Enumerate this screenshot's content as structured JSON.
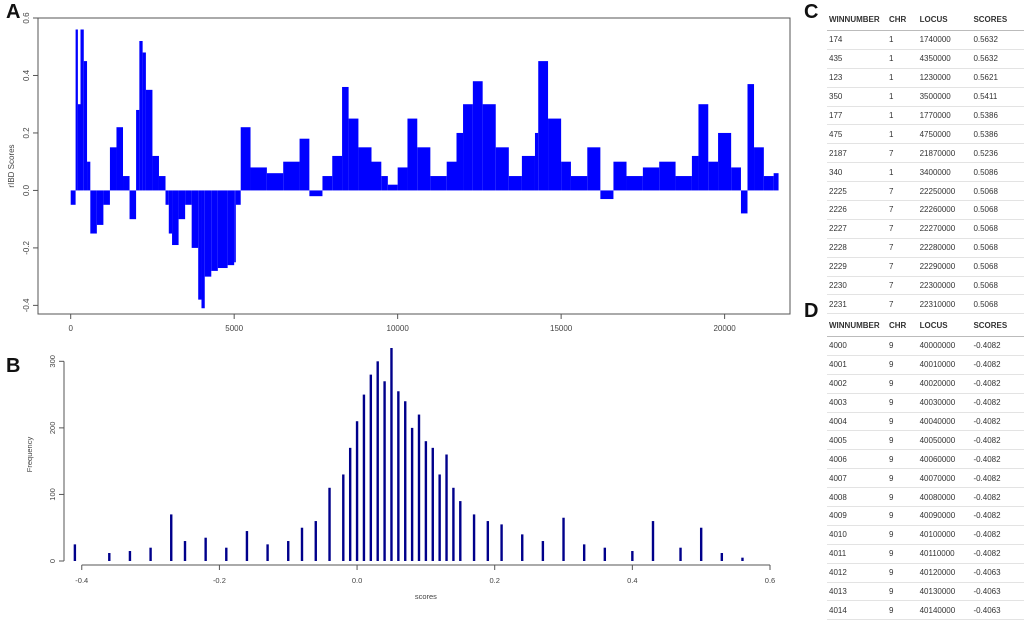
{
  "panels": {
    "a": "A",
    "b": "B",
    "c": "C",
    "d": "D"
  },
  "chart_data": [
    {
      "type": "bar",
      "ylabel": "rIBD Scores",
      "xlabel": "",
      "xlim": [
        -1000,
        22000
      ],
      "ylim": [
        -0.43,
        0.6
      ],
      "xticks": [
        "0",
        "5000",
        "10000",
        "15000",
        "20000"
      ],
      "yticks": [
        "-0.4",
        "-0.2",
        "0.0",
        "0.2",
        "0.4",
        "0.6"
      ],
      "color": "#0000ff",
      "x": [
        0,
        150,
        220,
        300,
        400,
        500,
        600,
        800,
        1000,
        1200,
        1400,
        1600,
        1800,
        2000,
        2100,
        2200,
        2300,
        2500,
        2700,
        2900,
        3000,
        3100,
        3300,
        3500,
        3700,
        3900,
        4000,
        4100,
        4300,
        4500,
        4800,
        5000,
        5050,
        5200,
        5500,
        6000,
        6500,
        7000,
        7300,
        7700,
        8000,
        8300,
        8500,
        8800,
        9200,
        9500,
        9700,
        10000,
        10300,
        10600,
        11000,
        11500,
        11800,
        12000,
        12300,
        12600,
        13000,
        13400,
        13800,
        14200,
        14300,
        14600,
        15000,
        15300,
        15800,
        16200,
        16600,
        17000,
        17500,
        18000,
        18500,
        19000,
        19200,
        19500,
        19800,
        20200,
        20500,
        20700,
        20900,
        21200,
        21500
      ],
      "values": [
        -0.05,
        0.56,
        0.3,
        0.56,
        0.45,
        0.1,
        -0.15,
        -0.12,
        -0.05,
        0.15,
        0.22,
        0.05,
        -0.1,
        0.28,
        0.52,
        0.48,
        0.35,
        0.12,
        0.05,
        -0.05,
        -0.15,
        -0.19,
        -0.1,
        -0.05,
        -0.2,
        -0.38,
        -0.41,
        -0.3,
        -0.28,
        -0.27,
        -0.26,
        -0.25,
        -0.05,
        0.22,
        0.08,
        0.06,
        0.1,
        0.18,
        -0.02,
        0.05,
        0.12,
        0.36,
        0.25,
        0.15,
        0.1,
        0.05,
        0.02,
        0.08,
        0.25,
        0.15,
        0.05,
        0.1,
        0.2,
        0.3,
        0.38,
        0.3,
        0.15,
        0.05,
        0.12,
        0.2,
        0.45,
        0.25,
        0.1,
        0.05,
        0.15,
        -0.03,
        0.1,
        0.05,
        0.08,
        0.1,
        0.05,
        0.12,
        0.3,
        0.1,
        0.2,
        0.08,
        -0.08,
        0.37,
        0.15,
        0.05,
        0.06
      ]
    },
    {
      "type": "bar",
      "xlabel": "scores",
      "ylabel": "Frequency",
      "xlim": [
        -0.42,
        0.6
      ],
      "ylim": [
        0,
        320
      ],
      "xticks": [
        "-0.4",
        "-0.2",
        "0.0",
        "0.2",
        "0.4",
        "0.6"
      ],
      "yticks": [
        "0",
        "100",
        "200",
        "300"
      ],
      "color": "#00008b",
      "x": [
        -0.41,
        -0.36,
        -0.33,
        -0.3,
        -0.27,
        -0.25,
        -0.22,
        -0.19,
        -0.16,
        -0.13,
        -0.1,
        -0.08,
        -0.06,
        -0.04,
        -0.02,
        -0.01,
        0.0,
        0.01,
        0.02,
        0.03,
        0.04,
        0.05,
        0.06,
        0.07,
        0.08,
        0.09,
        0.1,
        0.11,
        0.12,
        0.13,
        0.14,
        0.15,
        0.17,
        0.19,
        0.21,
        0.24,
        0.27,
        0.3,
        0.33,
        0.36,
        0.4,
        0.43,
        0.47,
        0.5,
        0.53,
        0.56
      ],
      "values": [
        25,
        12,
        15,
        20,
        70,
        30,
        35,
        20,
        45,
        25,
        30,
        50,
        60,
        110,
        130,
        170,
        210,
        250,
        280,
        300,
        270,
        320,
        255,
        240,
        200,
        220,
        180,
        170,
        130,
        160,
        110,
        90,
        70,
        60,
        55,
        40,
        30,
        65,
        25,
        20,
        15,
        60,
        20,
        50,
        12,
        5
      ]
    }
  ],
  "table_c": {
    "headers": [
      "WINNUMBER",
      "CHR",
      "LOCUS",
      "SCORES"
    ],
    "rows": [
      [
        "174",
        "1",
        "1740000",
        "0.5632"
      ],
      [
        "435",
        "1",
        "4350000",
        "0.5632"
      ],
      [
        "123",
        "1",
        "1230000",
        "0.5621"
      ],
      [
        "350",
        "1",
        "3500000",
        "0.5411"
      ],
      [
        "177",
        "1",
        "1770000",
        "0.5386"
      ],
      [
        "475",
        "1",
        "4750000",
        "0.5386"
      ],
      [
        "2187",
        "7",
        "21870000",
        "0.5236"
      ],
      [
        "340",
        "1",
        "3400000",
        "0.5086"
      ],
      [
        "2225",
        "7",
        "22250000",
        "0.5068"
      ],
      [
        "2226",
        "7",
        "22260000",
        "0.5068"
      ],
      [
        "2227",
        "7",
        "22270000",
        "0.5068"
      ],
      [
        "2228",
        "7",
        "22280000",
        "0.5068"
      ],
      [
        "2229",
        "7",
        "22290000",
        "0.5068"
      ],
      [
        "2230",
        "7",
        "22300000",
        "0.5068"
      ],
      [
        "2231",
        "7",
        "22310000",
        "0.5068"
      ]
    ]
  },
  "table_d": {
    "headers": [
      "WINNUMBER",
      "CHR",
      "LOCUS",
      "SCORES"
    ],
    "rows": [
      [
        "4000",
        "9",
        "40000000",
        "-0.4082"
      ],
      [
        "4001",
        "9",
        "40010000",
        "-0.4082"
      ],
      [
        "4002",
        "9",
        "40020000",
        "-0.4082"
      ],
      [
        "4003",
        "9",
        "40030000",
        "-0.4082"
      ],
      [
        "4004",
        "9",
        "40040000",
        "-0.4082"
      ],
      [
        "4005",
        "9",
        "40050000",
        "-0.4082"
      ],
      [
        "4006",
        "9",
        "40060000",
        "-0.4082"
      ],
      [
        "4007",
        "9",
        "40070000",
        "-0.4082"
      ],
      [
        "4008",
        "9",
        "40080000",
        "-0.4082"
      ],
      [
        "4009",
        "9",
        "40090000",
        "-0.4082"
      ],
      [
        "4010",
        "9",
        "40100000",
        "-0.4082"
      ],
      [
        "4011",
        "9",
        "40110000",
        "-0.4082"
      ],
      [
        "4012",
        "9",
        "40120000",
        "-0.4063"
      ],
      [
        "4013",
        "9",
        "40130000",
        "-0.4063"
      ],
      [
        "4014",
        "9",
        "40140000",
        "-0.4063"
      ]
    ]
  }
}
